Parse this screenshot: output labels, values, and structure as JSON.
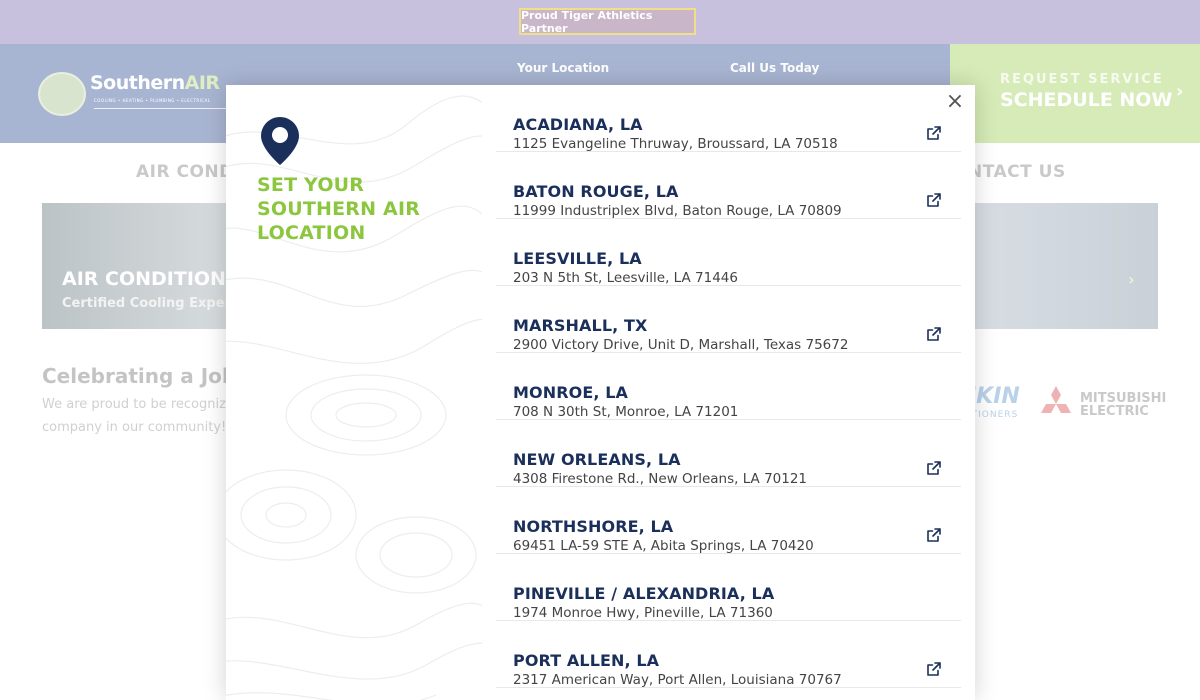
{
  "topbar": {
    "partner_badge": "Proud Tiger Athletics Partner"
  },
  "header": {
    "logo_text_1": "Southern",
    "logo_text_2": "AIR",
    "logo_tagline": "COOLING • HEATING • PLUMBING • ELECTRICAL",
    "your_location_label": "Your Location",
    "call_us_label": "Call Us Today",
    "request_small": "REQUEST SERVICE",
    "request_big": "SCHEDULE NOW",
    "request_arrow": "›"
  },
  "nav": {
    "left_item": "AIR CONDI",
    "right_item": "NTACT US"
  },
  "hero": {
    "title": "AIR CONDITIONIN",
    "subtitle": "Certified Cooling Expert",
    "arrow": "›"
  },
  "celebrate": {
    "title": "Celebrating a Job",
    "line1": "We are proud to be recogniz",
    "line2": "company in our community!"
  },
  "brands": {
    "daikin": "IKIN",
    "daikin_sub": "ITIONERS",
    "mitsubishi_1": "MITSUBISHI",
    "mitsubishi_2": "ELECTRIC"
  },
  "modal": {
    "heading": [
      "SET YOUR",
      "SOUTHERN AIR",
      "LOCATION"
    ],
    "close_label": "×",
    "colors": {
      "heading": "#8cc63f",
      "name": "#1b2f5b",
      "pin": "#1b2f5b"
    },
    "locations": [
      {
        "name": "ACADIANA, LA",
        "address": "1125 Evangeline Thruway, Broussard, LA 70518",
        "external": true
      },
      {
        "name": "BATON ROUGE, LA",
        "address": "11999 Industriplex Blvd, Baton Rouge, LA 70809",
        "external": true
      },
      {
        "name": "LEESVILLE, LA",
        "address": "203 N 5th St, Leesville, LA 71446",
        "external": false
      },
      {
        "name": "MARSHALL, TX",
        "address": "2900 Victory Drive, Unit D, Marshall, Texas 75672",
        "external": true
      },
      {
        "name": "MONROE, LA",
        "address": "708 N 30th St, Monroe, LA 71201",
        "external": false
      },
      {
        "name": "NEW ORLEANS, LA",
        "address": "4308 Firestone Rd., New Orleans, LA 70121",
        "external": true
      },
      {
        "name": "NORTHSHORE, LA",
        "address": "69451 LA-59 STE A, Abita Springs, LA 70420",
        "external": true
      },
      {
        "name": "PINEVILLE / ALEXANDRIA, LA",
        "address": "1974 Monroe Hwy, Pineville, LA 71360",
        "external": false
      },
      {
        "name": "PORT ALLEN, LA",
        "address": "2317 American Way, Port Allen, Louisiana 70767",
        "external": true
      }
    ]
  }
}
